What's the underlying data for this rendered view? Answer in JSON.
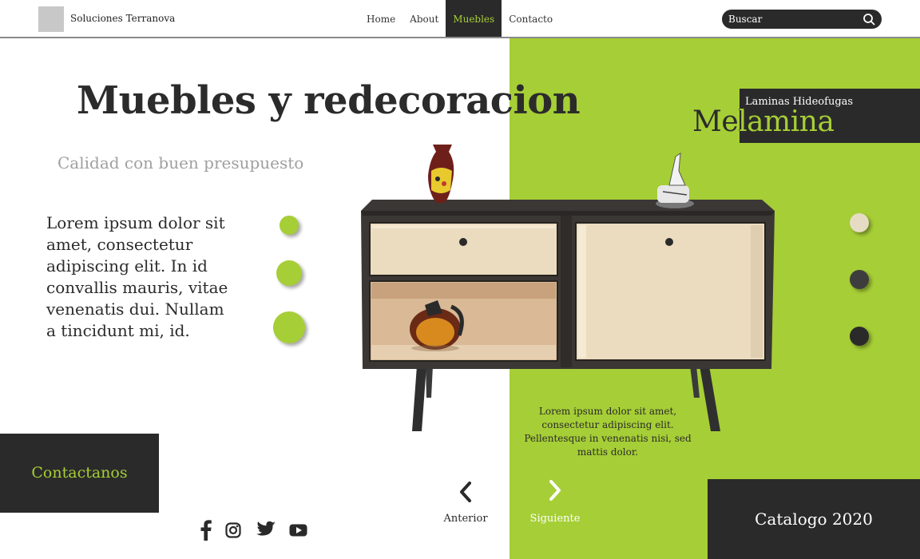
{
  "header": {
    "brand": "Soluciones Terranova",
    "nav": [
      {
        "label": "Home",
        "active": false
      },
      {
        "label": "About",
        "active": false
      },
      {
        "label": "Muebles",
        "active": true
      },
      {
        "label": "Contacto",
        "active": false
      }
    ],
    "search_placeholder": "Buscar",
    "search_icon": "search-icon"
  },
  "hero": {
    "title": "Muebles y redecoracion",
    "subtitle": "Calidad con buen presupuesto",
    "body": "Lorem ipsum dolor sit amet, consectetur adipiscing elit. In id convallis mauris, vitae venenatis dui. Nullam a tincidunt mi, id."
  },
  "feature": {
    "word": "Melamina",
    "badge_label": "Laminas Hideofugas",
    "body": "Lorem ipsum dolor sit amet, consectetur adipiscing elit. Pellentesque in venenatis nisi, sed mattis dolor."
  },
  "pagination": {
    "prev_label": "Anterior",
    "next_label": "Siguiente"
  },
  "actions": {
    "contact_label": "Contactanos",
    "catalog_label": "Catalogo 2020"
  },
  "social": [
    "facebook-icon",
    "instagram-icon",
    "twitter-icon",
    "youtube-icon"
  ],
  "colors": {
    "accent": "#a6ce36",
    "dark": "#2a2a2a",
    "swatch_cream": "#e6dcc3",
    "swatch_gray": "#3d3d3d",
    "swatch_black": "#2a2a2a"
  }
}
